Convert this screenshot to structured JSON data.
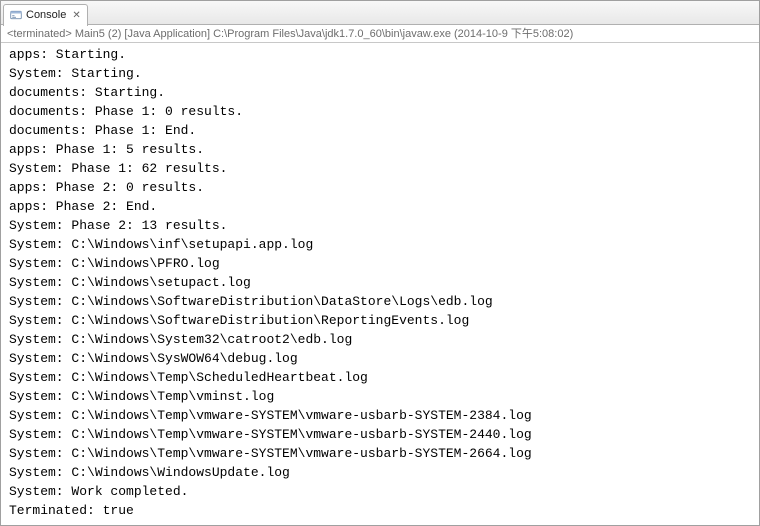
{
  "tab": {
    "title": "Console"
  },
  "info_bar": {
    "state": "<terminated>",
    "launch": "Main5 (2) [Java Application]",
    "path": "C:\\Program Files\\Java\\jdk1.7.0_60\\bin\\javaw.exe",
    "timestamp": "(2014-10-9 下午5:08:02)"
  },
  "console_lines": [
    "apps: Starting.",
    "System: Starting.",
    "documents: Starting.",
    "documents: Phase 1: 0 results.",
    "documents: Phase 1: End.",
    "apps: Phase 1: 5 results.",
    "System: Phase 1: 62 results.",
    "apps: Phase 2: 0 results.",
    "apps: Phase 2: End.",
    "System: Phase 2: 13 results.",
    "System: C:\\Windows\\inf\\setupapi.app.log",
    "System: C:\\Windows\\PFRO.log",
    "System: C:\\Windows\\setupact.log",
    "System: C:\\Windows\\SoftwareDistribution\\DataStore\\Logs\\edb.log",
    "System: C:\\Windows\\SoftwareDistribution\\ReportingEvents.log",
    "System: C:\\Windows\\System32\\catroot2\\edb.log",
    "System: C:\\Windows\\SysWOW64\\debug.log",
    "System: C:\\Windows\\Temp\\ScheduledHeartbeat.log",
    "System: C:\\Windows\\Temp\\vminst.log",
    "System: C:\\Windows\\Temp\\vmware-SYSTEM\\vmware-usbarb-SYSTEM-2384.log",
    "System: C:\\Windows\\Temp\\vmware-SYSTEM\\vmware-usbarb-SYSTEM-2440.log",
    "System: C:\\Windows\\Temp\\vmware-SYSTEM\\vmware-usbarb-SYSTEM-2664.log",
    "System: C:\\Windows\\WindowsUpdate.log",
    "System: Work completed.",
    "Terminated: true"
  ]
}
